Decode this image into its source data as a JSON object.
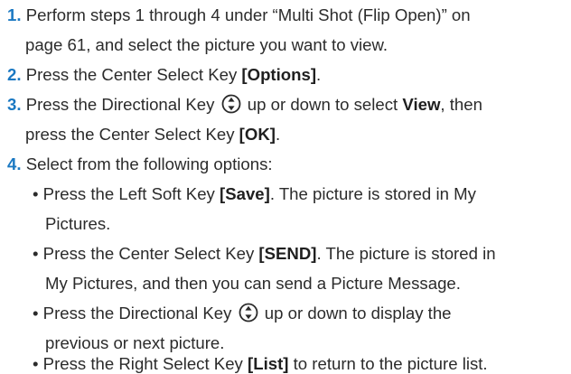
{
  "steps": [
    {
      "num": "1.",
      "line1": "Perform steps 1 through 4 under “Multi Shot (Flip Open)” on",
      "line2": "page 61, and select the picture you want to view."
    },
    {
      "num": "2.",
      "pre": "Press the Center Select Key ",
      "key": "[Options]",
      "post": "."
    },
    {
      "num": "3.",
      "pre": "Press the Directional Key",
      "mid": " up or down to select ",
      "bold": "View",
      "post": ", then",
      "line2_pre": "press the Center Select Key ",
      "line2_key": "[OK]",
      "line2_post": "."
    },
    {
      "num": "4.",
      "text": "Select from the following options:"
    }
  ],
  "bullets": [
    {
      "line1_pre": "• Press the Left Soft Key ",
      "line1_key": "[Save]",
      "line1_post": ". The picture is stored in My",
      "line2": "Pictures."
    },
    {
      "line1_pre": "• Press the Center Select Key ",
      "line1_key": "[SEND]",
      "line1_post": ". The picture is stored in",
      "line2": "My Pictures, and then you can send a Picture Message."
    },
    {
      "line1_pre": "• Press the Directional Key",
      "line1_post": " up or down to display the",
      "line2": "previous or next picture."
    },
    {
      "line1_pre": "• Press the Right Select Key ",
      "line1_key": "[List]",
      "line1_post": " to return to the picture list."
    }
  ],
  "icons": {
    "directional_key": "directional-key-icon"
  },
  "colors": {
    "step_number": "#1a78c2",
    "text": "#2b2b2b"
  }
}
